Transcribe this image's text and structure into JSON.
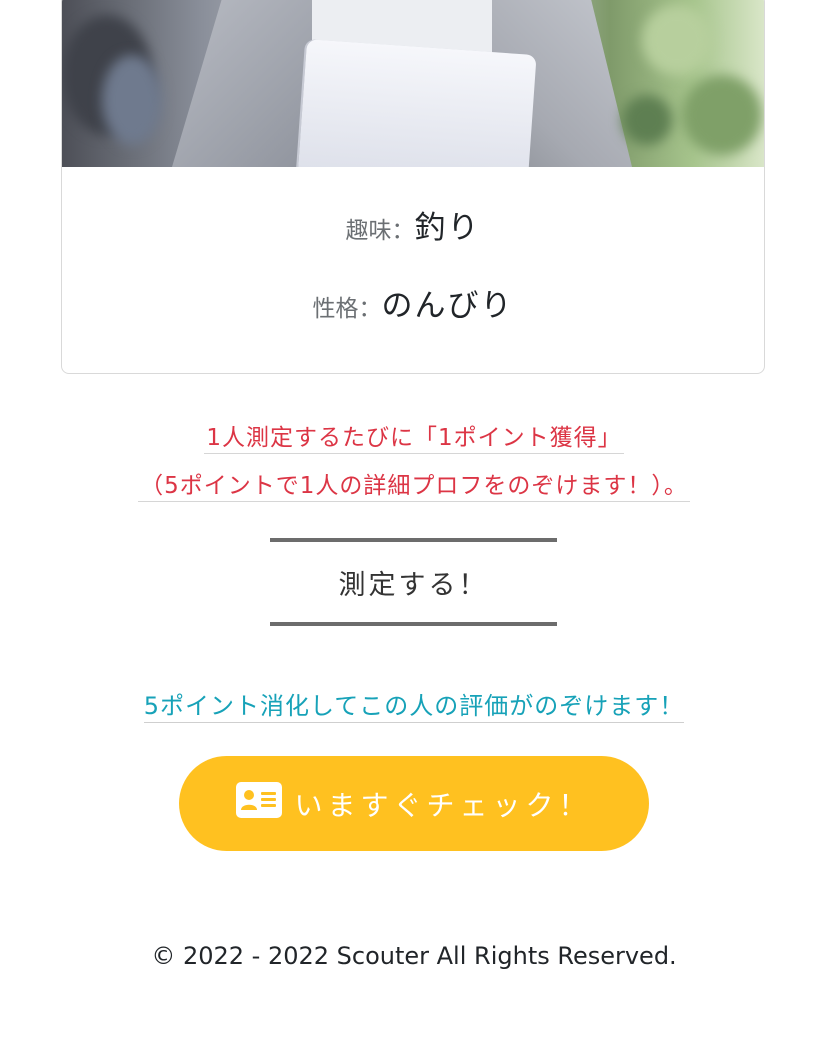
{
  "profile": {
    "hobby_label": "趣味：",
    "hobby_value": "釣り",
    "personality_label": "性格：",
    "personality_value": "のんびり"
  },
  "notice": {
    "line1": "1人測定するたびに「1ポイント獲得」",
    "line2": "（5ポイントで1人の詳細プロフをのぞけます！）。",
    "color": "#dc3545"
  },
  "measure_button": {
    "label": "測定する！"
  },
  "evaluation": {
    "link_text": "5ポイント消化してこの人の評価がのぞけます！",
    "color": "#17a2b8"
  },
  "check_button": {
    "label": "いますぐチェック！",
    "icon": "id-card-icon",
    "color": "#ffc120"
  },
  "footer": {
    "copyright": "© 2022 - 2022 Scouter All Rights Reserved."
  }
}
